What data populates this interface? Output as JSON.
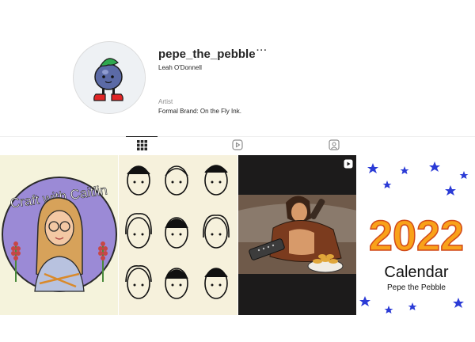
{
  "profile": {
    "username": "pepe_the_pebble",
    "more_label": "···",
    "full_name": "Leah O'Donnell",
    "category": "Artist",
    "bio": "Formal Brand: On the Fly Ink."
  },
  "tabs": [
    {
      "name": "posts",
      "icon": "grid-icon",
      "active": true
    },
    {
      "name": "reels",
      "icon": "reels-icon",
      "active": false
    },
    {
      "name": "tagged",
      "icon": "tagged-user-icon",
      "active": false
    }
  ],
  "posts": [
    {
      "image": "craft-with-caitlin-illustration",
      "text": "Craft with Caitlin"
    },
    {
      "image": "faces-sketch-grid"
    },
    {
      "image": "couch-remote-illustration",
      "badge": "reel-icon"
    },
    {
      "image": "calendar-illustration",
      "text_year": "2022",
      "text_title": "Calendar",
      "text_byline": "Pepe the Pebble"
    }
  ],
  "colors": {
    "text_primary": "#262626",
    "text_secondary": "#8e8e8e",
    "divider": "#efefef",
    "calendar_orange": "#f9a21a",
    "calendar_stars": "#2b3bd6",
    "craft_purple": "#9b8ad6"
  }
}
